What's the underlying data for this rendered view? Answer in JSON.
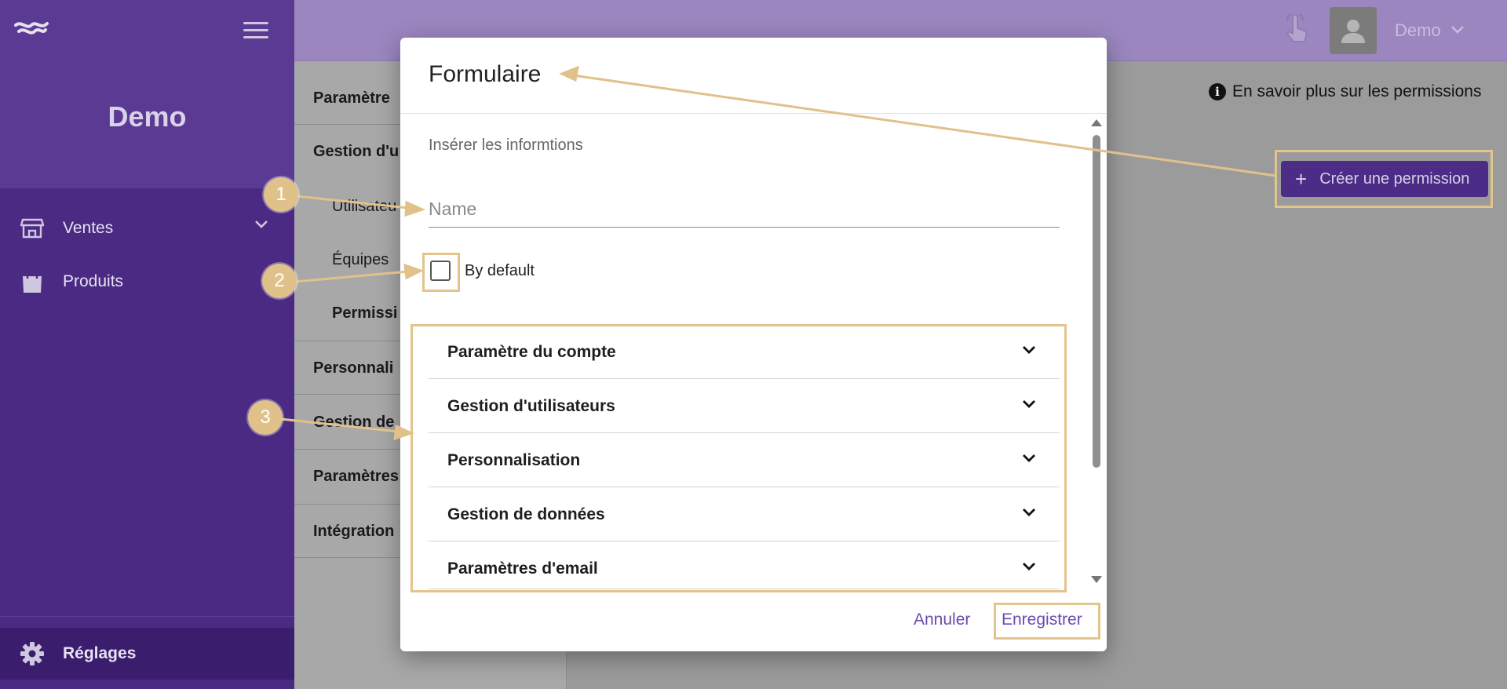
{
  "colors": {
    "brand_purple": "#4a2a82",
    "accent_purple": "#6a4ab0",
    "annotation": "#e1c18a"
  },
  "sidebar": {
    "brand": "Demo",
    "items": [
      {
        "label": "Ventes",
        "icon": "store-icon",
        "expandable": true
      },
      {
        "label": "Produits",
        "icon": "shopping-bag-icon"
      }
    ],
    "bottom_item": {
      "label": "Réglages",
      "icon": "gear-icon"
    }
  },
  "topbar": {
    "user_name": "Demo"
  },
  "settings_nav": {
    "sections": [
      {
        "label": "Paramètre"
      },
      {
        "label": "Gestion d'u"
      },
      {
        "label": "Utilisateu",
        "sub": true
      },
      {
        "label": "Équipes",
        "sub": true
      },
      {
        "label": "Permissi",
        "sub": true
      },
      {
        "label": "Personnali"
      },
      {
        "label": "Gestion de"
      },
      {
        "label": "Paramètres"
      },
      {
        "label": "Intégration"
      }
    ]
  },
  "main": {
    "info_link": "En savoir plus sur les permissions",
    "create_button": "Créer une permission"
  },
  "modal": {
    "title": "Formulaire",
    "subtitle": "Insérer les informtions",
    "name_placeholder": "Name",
    "name_value": "",
    "checkbox_label": "By default",
    "checkbox_checked": false,
    "accordion": [
      "Paramètre du compte",
      "Gestion d'utilisateurs",
      "Personnalisation",
      "Gestion de données",
      "Paramètres d'email"
    ],
    "cancel_label": "Annuler",
    "save_label": "Enregistrer"
  },
  "annotations": {
    "badges": [
      "1",
      "2",
      "3"
    ]
  }
}
